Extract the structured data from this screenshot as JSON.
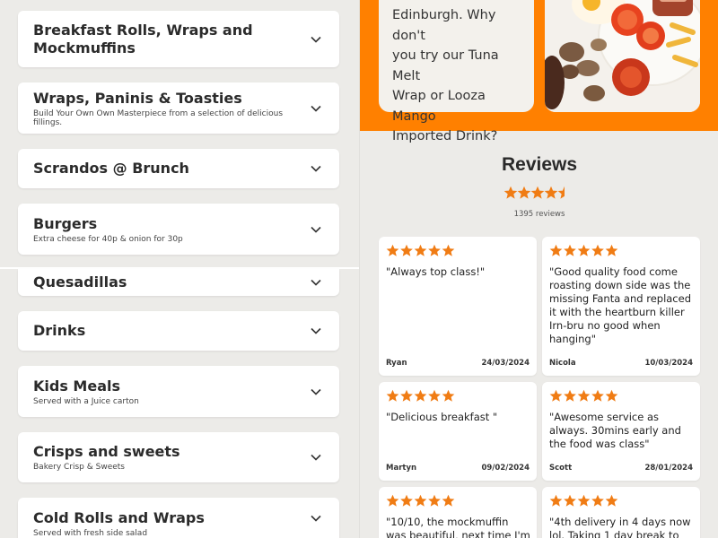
{
  "menu": {
    "categories": [
      {
        "title": "Breakfast Rolls, Wraps and Mockmuffins",
        "subtitle": ""
      },
      {
        "title": "Wraps, Paninis & Toasties",
        "subtitle": "Build Your Own Own Masterpiece from a selection of delicious fillings."
      },
      {
        "title": "Scrandos @ Brunch",
        "subtitle": ""
      },
      {
        "title": "Burgers",
        "subtitle": "Extra cheese for 40p & onion for 30p"
      },
      {
        "title": "Quesadillas",
        "subtitle": ""
      },
      {
        "title": "Drinks",
        "subtitle": ""
      },
      {
        "title": "Kids Meals",
        "subtitle": "Served with a Juice carton"
      },
      {
        "title": "Crisps and sweets",
        "subtitle": "Bakery Crisp & Sweets"
      },
      {
        "title": "Cold Rolls and Wraps",
        "subtitle": "Served with fresh side salad"
      }
    ]
  },
  "promo": {
    "text_line1": "Edinburgh. Why don't",
    "text_line2": "you try our Tuna Melt",
    "text_line3": "Wrap or Looza Mango",
    "text_line4": "Imported Drink?"
  },
  "reviews": {
    "heading": "Reviews",
    "rating": 4.5,
    "count_label": "1395 reviews",
    "items": [
      {
        "stars": 5,
        "text": "\"Always top class!\"",
        "author": "Ryan",
        "date": "24/03/2024"
      },
      {
        "stars": 5,
        "text": "\"Good quality food come roasting down side was the missing Fanta and replaced it with the heartburn killer Irn-bru no good when hanging\"",
        "author": "Nicola",
        "date": "10/03/2024"
      },
      {
        "stars": 5,
        "text": "\"Delicious breakfast  \"",
        "author": "Martyn",
        "date": "09/02/2024"
      },
      {
        "stars": 5,
        "text": "\"Awesome service as always. 30mins early and the food was class\"",
        "author": "Scott",
        "date": "28/01/2024"
      },
      {
        "stars": 5,
        "text": "\"10/10, the mockmuffin was beautiful, next time I'm",
        "author": "",
        "date": ""
      },
      {
        "stars": 5,
        "text": "\"4th delivery in 4 days now lol. Taking 1 day break to",
        "author": "",
        "date": ""
      }
    ]
  },
  "colors": {
    "accent": "#ff8000",
    "star": "#f07c14"
  },
  "icons": {
    "chevron": "chevron-down-icon",
    "star": "star-icon"
  }
}
